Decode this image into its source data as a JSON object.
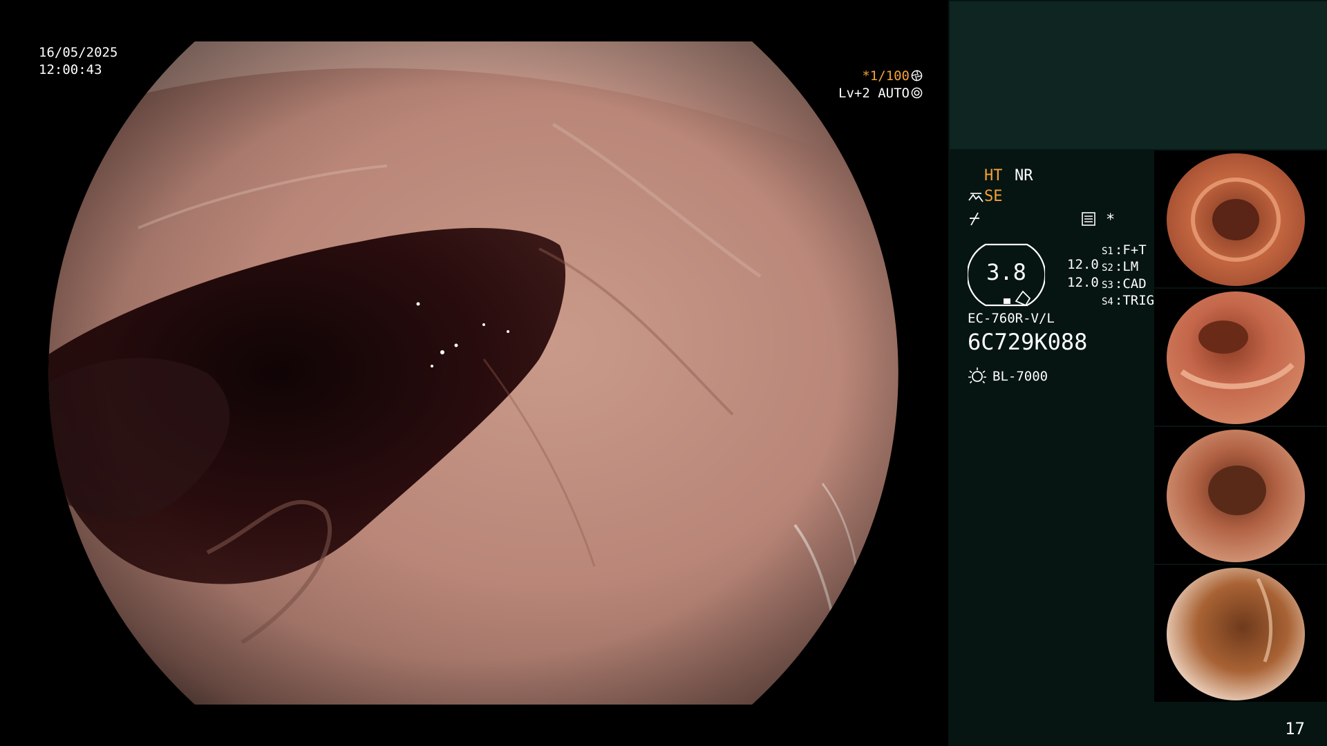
{
  "osd": {
    "date": "16/05/2025",
    "time": "12:00:43",
    "shutter": "*1/100",
    "shutter_icon": "shutter-icon",
    "iris": "Lv+2 AUTO",
    "iris_icon": "iris-icon"
  },
  "panel": {
    "ht": "HT",
    "nr": "NR",
    "se": "SE",
    "star": "*",
    "icons": [
      "structure-enhancement-icon",
      "freeze-icon",
      "memo-icon",
      "lamp-icon"
    ],
    "ratio": "3.8",
    "val1": "12.0",
    "val2": "12.0",
    "slots": [
      {
        "key": "S1",
        "value": "F+T"
      },
      {
        "key": "S2",
        "value": "LM"
      },
      {
        "key": "S3",
        "value": "CAD"
      },
      {
        "key": "S4",
        "value": "TRIG"
      }
    ],
    "scope_model": "EC-760R-V/L",
    "serial": "6C729K088",
    "lamp": "BL-7000"
  },
  "page_number": "17",
  "colors": {
    "background": "#000000",
    "panel_bg": "#061512",
    "panel_top": "#0e2522",
    "accent_orange": "#f5a23b",
    "text": "#ffffff"
  }
}
